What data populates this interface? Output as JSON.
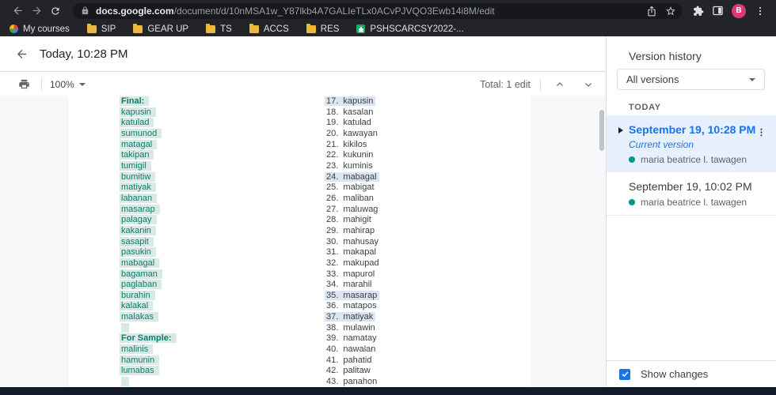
{
  "browser": {
    "url_host": "docs.google.com",
    "url_path": "/document/d/10nMSA1w_Y87lkb4A7GALIeTLx0ACvPJVQO3Ewb14i8M/edit",
    "avatar_letter": "B",
    "bookmarks": [
      {
        "label": "My courses",
        "icon": "pinwheel"
      },
      {
        "label": "SIP",
        "icon": "folder"
      },
      {
        "label": "GEAR UP",
        "icon": "folder"
      },
      {
        "label": "TS",
        "icon": "folder"
      },
      {
        "label": "ACCS",
        "icon": "folder"
      },
      {
        "label": "RES",
        "icon": "folder"
      },
      {
        "label": "PSHSCARCSY2022-...",
        "icon": "sheets"
      }
    ]
  },
  "header": {
    "title": "Today, 10:28 PM"
  },
  "toolbar": {
    "zoom_level": "100%",
    "total_edits": "Total: 1 edit"
  },
  "document": {
    "left_column": [
      {
        "text": "Final:",
        "header": true
      },
      {
        "text": "kapusin"
      },
      {
        "text": "katulad"
      },
      {
        "text": "sumunod"
      },
      {
        "text": "matagal"
      },
      {
        "text": "takipan"
      },
      {
        "text": "tumigil"
      },
      {
        "text": "bumitiw"
      },
      {
        "text": "matiyak"
      },
      {
        "text": "labanan"
      },
      {
        "text": "masarap"
      },
      {
        "text": "palagay"
      },
      {
        "text": "kakanin"
      },
      {
        "text": "sasapit"
      },
      {
        "text": "pasukin"
      },
      {
        "text": "mabagal"
      },
      {
        "text": "bagaman"
      },
      {
        "text": "paglaban"
      },
      {
        "text": "burahin"
      },
      {
        "text": "kalakal"
      },
      {
        "text": "malakas"
      },
      {
        "empty": true
      },
      {
        "text": "For Sample:",
        "header": true
      },
      {
        "text": "malinis"
      },
      {
        "text": "hamunin"
      },
      {
        "text": "lumabas"
      },
      {
        "empty": true
      }
    ],
    "right_column": [
      {
        "number": "17.",
        "word": "kapusin",
        "highlighted": true
      },
      {
        "number": "18.",
        "word": "kasalan"
      },
      {
        "number": "19.",
        "word": "katulad"
      },
      {
        "number": "20.",
        "word": "kawayan"
      },
      {
        "number": "21.",
        "word": "kikilos"
      },
      {
        "number": "22.",
        "word": "kukunin"
      },
      {
        "number": "23.",
        "word": "kuminis"
      },
      {
        "number": "24.",
        "word": "mabagal",
        "highlighted": true
      },
      {
        "number": "25.",
        "word": "mabigat"
      },
      {
        "number": "26.",
        "word": "maliban"
      },
      {
        "number": "27.",
        "word": "maluwag"
      },
      {
        "number": "28.",
        "word": "mahigit"
      },
      {
        "number": "29.",
        "word": "mahirap"
      },
      {
        "number": "30.",
        "word": "mahusay"
      },
      {
        "number": "31.",
        "word": "makapal"
      },
      {
        "number": "32.",
        "word": "makupad"
      },
      {
        "number": "33.",
        "word": "mapurol"
      },
      {
        "number": "34.",
        "word": "marahil"
      },
      {
        "number": "35.",
        "word": "masarap",
        "highlighted": true
      },
      {
        "number": "36.",
        "word": "matapos"
      },
      {
        "number": "37.",
        "word": "matiyak",
        "highlighted": true
      },
      {
        "number": "38.",
        "word": "mulawin"
      },
      {
        "number": "39.",
        "word": "namatay"
      },
      {
        "number": "40.",
        "word": "nawalan"
      },
      {
        "number": "41.",
        "word": "pahatid"
      },
      {
        "number": "42.",
        "word": "palitaw"
      },
      {
        "number": "43.",
        "word": "panahon"
      }
    ]
  },
  "sidebar": {
    "title": "Version history",
    "filter_value": "All versions",
    "group_label": "TODAY",
    "versions": [
      {
        "title": "September 19, 10:28 PM",
        "subtitle": "Current version",
        "author": "maria beatrice l. tawagen",
        "selected": true
      },
      {
        "title": "September 19, 10:02 PM",
        "author": "maria beatrice l. tawagen",
        "selected": false
      }
    ],
    "show_changes_label": "Show changes",
    "show_changes_checked": true
  },
  "colors": {
    "accent_blue": "#1a73e8",
    "added_text_teal": "#0e7b6c",
    "added_highlight_bg": "#d9eae5",
    "match_highlight_bg": "#dbe4f0",
    "selected_version_bg": "#e8f0fe",
    "author_dot_teal": "#009688",
    "avatar_pink": "#dd3b75"
  }
}
